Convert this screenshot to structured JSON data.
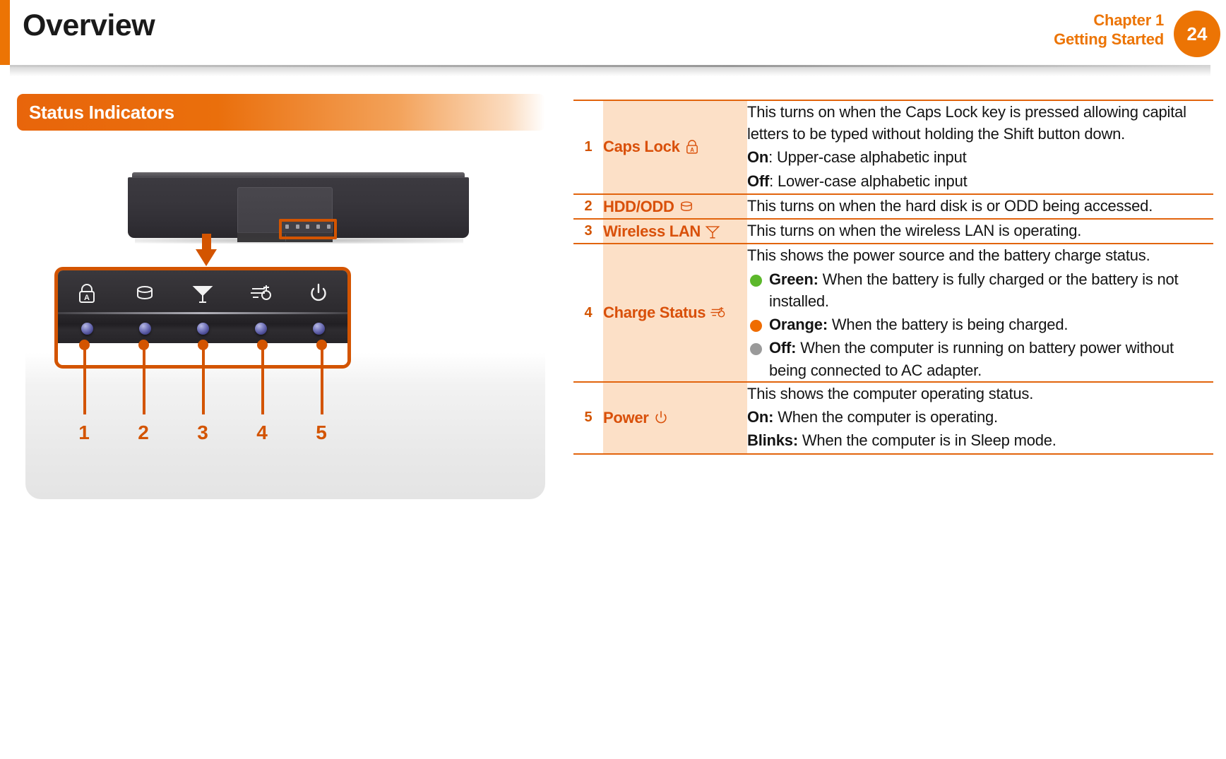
{
  "header": {
    "title": "Overview",
    "chapter_line1": "Chapter 1",
    "chapter_line2": "Getting Started",
    "page_number": "24",
    "accent_color": "#ec7404"
  },
  "section": {
    "title": "Status Indicators"
  },
  "illustration": {
    "callout_icons": [
      {
        "name": "caps-lock-icon",
        "label": "Caps Lock"
      },
      {
        "name": "hdd-odd-icon",
        "label": "HDD/ODD"
      },
      {
        "name": "wireless-lan-icon",
        "label": "Wireless LAN"
      },
      {
        "name": "charge-status-icon",
        "label": "Charge Status"
      },
      {
        "name": "power-icon",
        "label": "Power"
      }
    ],
    "callout_numbers": [
      "1",
      "2",
      "3",
      "4",
      "5"
    ],
    "led_color": "#6f71b8",
    "callout_border_color": "#d35400"
  },
  "table": {
    "rows": [
      {
        "num": "1",
        "label": "Caps Lock",
        "icon": "caps-lock-icon",
        "lines": [
          {
            "type": "text",
            "html": "This turns on when the Caps Lock key is pressed allowing capital letters to be typed without holding the Shift button down."
          },
          {
            "type": "text",
            "bold": "On",
            "rest": ": Upper-case alphabetic input"
          },
          {
            "type": "text",
            "bold": "Off",
            "rest": ": Lower-case alphabetic input"
          }
        ]
      },
      {
        "num": "2",
        "label": "HDD/ODD",
        "icon": "hdd-odd-icon",
        "lines": [
          {
            "type": "text",
            "html": "This turns on when the hard disk is or ODD being accessed."
          }
        ]
      },
      {
        "num": "3",
        "label": "Wireless LAN",
        "icon": "wireless-lan-icon",
        "lines": [
          {
            "type": "text",
            "html": "This turns on when the wireless LAN is operating."
          }
        ]
      },
      {
        "num": "4",
        "label": "Charge Status",
        "icon": "charge-status-icon",
        "lines": [
          {
            "type": "text",
            "html": "This shows the power source and the battery charge status."
          },
          {
            "type": "bullet",
            "color": "#5cb82b",
            "bold": "Green:",
            "rest": " When the battery is fully charged or the battery is not installed."
          },
          {
            "type": "bullet",
            "color": "#ef6c00",
            "bold": "Orange:",
            "rest": " When the battery is being charged."
          },
          {
            "type": "bullet",
            "color": "#9a9a9a",
            "bold": "Off:",
            "rest": " When the computer is running on battery power without being connected to AC adapter."
          }
        ]
      },
      {
        "num": "5",
        "label": "Power",
        "icon": "power-icon",
        "lines": [
          {
            "type": "text",
            "html": "This shows the computer operating status."
          },
          {
            "type": "text",
            "bold": "On:",
            "rest": " When the computer is operating."
          },
          {
            "type": "text",
            "bold": "Blinks:",
            "rest": " When the computer is in Sleep mode."
          }
        ]
      }
    ]
  }
}
